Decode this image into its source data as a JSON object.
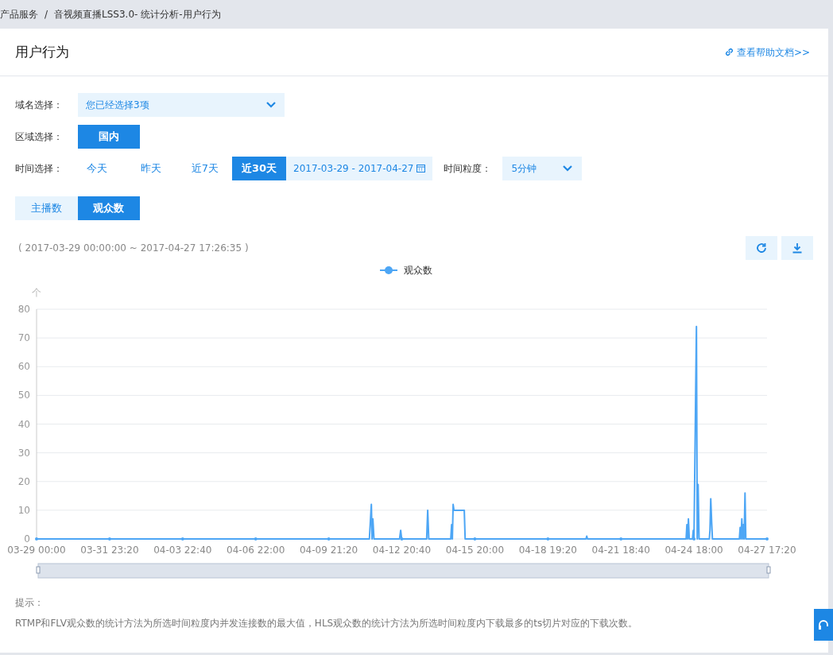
{
  "breadcrumb": [
    {
      "label": "产品服务"
    },
    {
      "label": "音视频直播LSS3.0- 统计分析-用户行为"
    }
  ],
  "breadcrumb_separator": "/",
  "title": "用户行为",
  "help_link": "查看帮助文档>>",
  "filters": {
    "domain": {
      "label": "域名选择：",
      "value": "您已经选择3项"
    },
    "region": {
      "label": "区域选择：",
      "options": [
        {
          "label": "国内",
          "selected": true
        }
      ]
    },
    "time": {
      "label": "时间选择：",
      "options": [
        {
          "label": "今天",
          "selected": false
        },
        {
          "label": "昨天",
          "selected": false
        },
        {
          "label": "近7天",
          "selected": false
        },
        {
          "label": "近30天",
          "selected": true
        }
      ],
      "range": "2017-03-29 - 2017-04-27"
    },
    "granularity": {
      "label": "时间粒度：",
      "value": "5分钟"
    }
  },
  "metric_tabs": [
    {
      "label": "主播数",
      "selected": false
    },
    {
      "label": "观众数",
      "selected": true
    }
  ],
  "range_text": "( 2017-03-29 00:00:00 ~ 2017-04-27 17:26:35 )",
  "chart": {
    "chart_data": {
      "type": "line",
      "grid": true,
      "ylabel": "个",
      "xlim": [
        "2017-03-29 00:00",
        "2017-04-27 17:20"
      ],
      "ylim": [
        0,
        80
      ],
      "yticks": [
        0,
        10,
        20,
        30,
        40,
        50,
        60,
        70,
        80
      ],
      "xticks": [
        {
          "value": "2017-03-29 00:00",
          "label": "03-29 00:00"
        },
        {
          "value": "2017-03-31 23:20",
          "label": "03-31 23:20"
        },
        {
          "value": "2017-04-03 22:40",
          "label": "04-03 22:40"
        },
        {
          "value": "2017-04-06 22:00",
          "label": "04-06 22:00"
        },
        {
          "value": "2017-04-09 21:20",
          "label": "04-09 21:20"
        },
        {
          "value": "2017-04-12 20:40",
          "label": "04-12 20:40"
        },
        {
          "value": "2017-04-15 20:00",
          "label": "04-15 20:00"
        },
        {
          "value": "2017-04-18 19:20",
          "label": "04-18 19:20"
        },
        {
          "value": "2017-04-21 18:40",
          "label": "04-21 18:40"
        },
        {
          "value": "2017-04-24 18:00",
          "label": "04-24 18:00"
        },
        {
          "value": "2017-04-27 17:20",
          "label": "04-27 17:20"
        }
      ],
      "x": [
        "2017-03-29 00:00",
        "2017-04-11 13:00",
        "2017-04-11 14:54",
        "2017-04-11 15:36",
        "2017-04-11 16:24",
        "2017-04-11 17:30",
        "2017-04-12 18:30",
        "2017-04-12 19:36",
        "2017-04-12 20:30",
        "2017-04-13 21:00",
        "2017-04-13 22:00",
        "2017-04-13 23:00",
        "2017-04-14 20:30",
        "2017-04-14 21:18",
        "2017-04-14 22:00",
        "2017-04-14 22:48",
        "2017-04-14 23:36",
        "2017-04-15 00:24",
        "2017-04-15 09:42",
        "2017-04-15 10:30",
        "2017-04-20 08:30",
        "2017-04-20 09:18",
        "2017-04-20 10:00",
        "2017-04-24 10:18",
        "2017-04-24 11:06",
        "2017-04-24 11:48",
        "2017-04-24 12:36",
        "2017-04-24 13:24",
        "2017-04-24 16:30",
        "2017-04-24 17:18",
        "2017-04-24 18:00",
        "2017-04-24 20:24",
        "2017-04-24 21:12",
        "2017-04-24 22:00",
        "2017-04-24 23:00",
        "2017-04-25 09:00",
        "2017-04-25 09:36",
        "2017-04-25 10:24",
        "2017-04-25 11:12",
        "2017-04-25 12:00",
        "2017-04-26 14:18",
        "2017-04-26 15:06",
        "2017-04-26 15:54",
        "2017-04-26 16:42",
        "2017-04-26 17:30",
        "2017-04-26 18:12",
        "2017-04-26 19:00",
        "2017-04-26 19:48",
        "2017-04-26 20:36",
        "2017-04-27 17:20"
      ],
      "series": [
        {
          "name": "观众数",
          "color": "#4da6f5",
          "values": [
            0,
            0,
            12,
            0,
            7,
            0,
            0,
            3,
            0,
            0,
            10,
            0,
            0,
            5,
            0,
            12,
            10,
            10,
            10,
            0,
            0,
            1,
            0,
            0,
            5,
            0,
            7,
            0,
            0,
            3,
            0,
            74,
            0,
            19,
            0,
            0,
            3,
            14,
            6,
            0,
            0,
            4,
            0,
            7,
            0,
            5,
            0,
            16,
            0,
            0
          ]
        }
      ]
    }
  },
  "tips": {
    "heading": "提示：",
    "text": "RTMP和FLV观众数的统计方法为所选时间粒度内并发连接数的最大值，HLS观众数的统计方法为所选时间粒度内下载最多的ts切片对应的下载次数。"
  }
}
